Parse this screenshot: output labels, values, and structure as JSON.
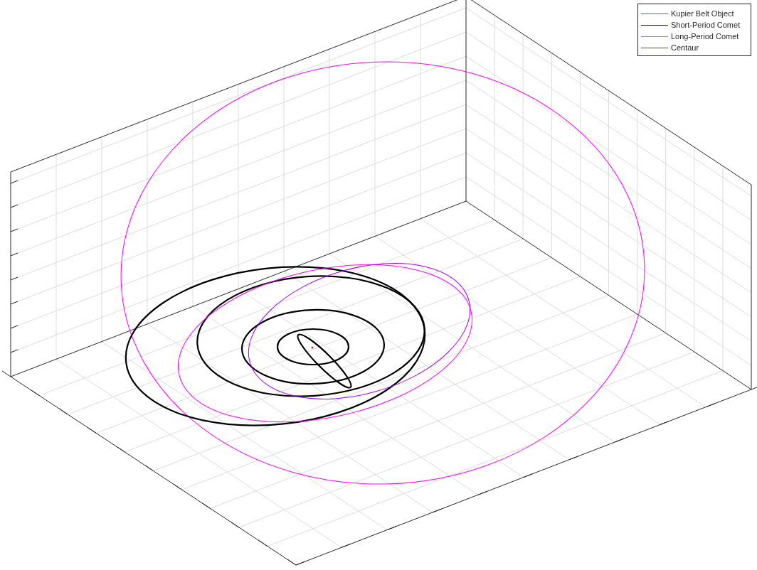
{
  "figure": {
    "legend": [
      {
        "label": "Kupier Belt Object",
        "color": "#ff00ff"
      },
      {
        "label": "Short-Period Comet",
        "color": "#0000b0"
      },
      {
        "label": "Long-Period Comet",
        "color": "#00c8ff"
      },
      {
        "label": "Centaur",
        "color": "#a000ff"
      }
    ]
  }
}
